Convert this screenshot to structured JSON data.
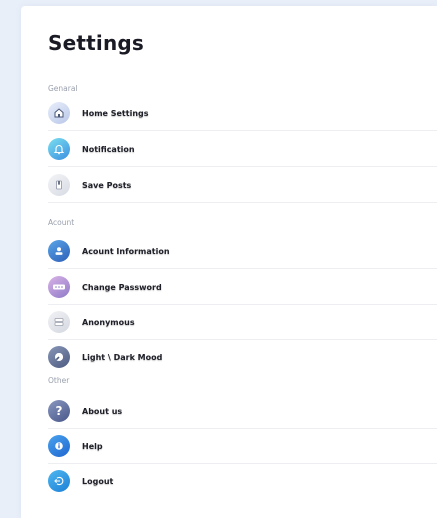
{
  "page": {
    "title": "Settings"
  },
  "sections": [
    {
      "label": "Genaral",
      "items": [
        {
          "label": "Home Settings",
          "icon": "home-icon"
        },
        {
          "label": "Notification",
          "icon": "bell-icon"
        },
        {
          "label": "Save Posts",
          "icon": "bookmark-icon"
        }
      ]
    },
    {
      "label": "Acount",
      "items": [
        {
          "label": "Acount Information",
          "icon": "user-icon"
        },
        {
          "label": "Change Password",
          "icon": "password-icon"
        },
        {
          "label": "Anonymous",
          "icon": "anonymous-icon"
        },
        {
          "label": "Light \\ Dark Mood",
          "icon": "contrast-icon"
        }
      ]
    },
    {
      "label": "Other",
      "items": [
        {
          "label": "About us",
          "icon": "question-icon"
        },
        {
          "label": "Help",
          "icon": "info-icon"
        },
        {
          "label": "Logout",
          "icon": "logout-icon"
        }
      ]
    }
  ],
  "colors": {
    "background": "#e9eff9",
    "panel": "#ffffff",
    "text": "#1e1f28",
    "section_text": "#9aa0ad",
    "divider": "#eceef2"
  }
}
